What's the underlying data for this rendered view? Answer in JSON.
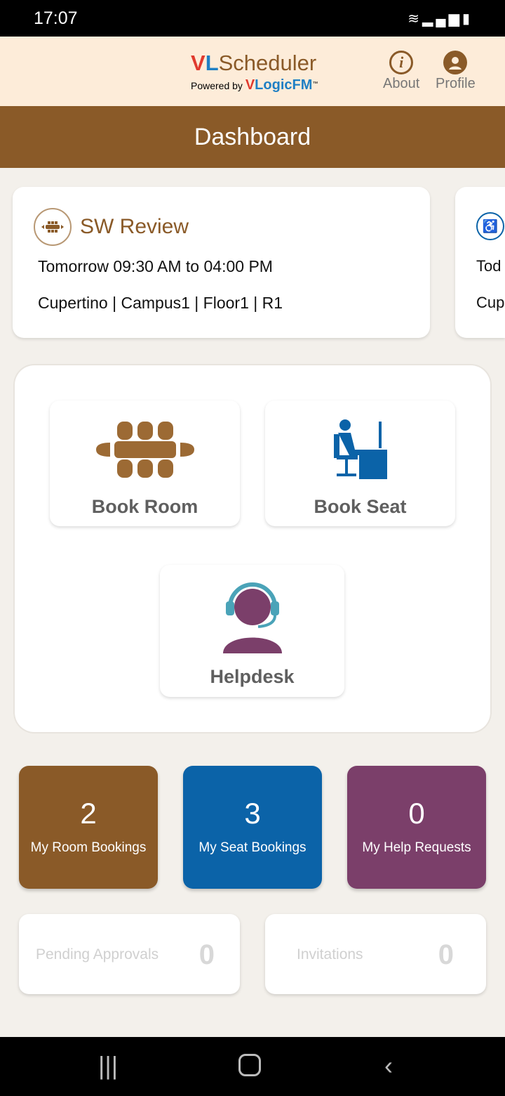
{
  "status_bar": {
    "time": "17:07",
    "icons": [
      "wifi-icon",
      "signal-icon",
      "battery-icon"
    ]
  },
  "header": {
    "logo_vl_v": "V",
    "logo_vl_l": "L",
    "logo_name": "Scheduler",
    "powered_by": "Powered by",
    "brand_v": "V",
    "brand_rest": "LogicFM",
    "tm": "™",
    "about": "About",
    "profile": "Profile"
  },
  "title": "Dashboard",
  "bookings": [
    {
      "title": "SW Review",
      "time": "Tomorrow 09:30 AM to 04:00 PM",
      "location": "Cupertino | Campus1 | Floor1 | R1",
      "icon": "meeting-table-icon"
    },
    {
      "title": "",
      "time": "Tod",
      "location": "Cup",
      "icon": "desk-seat-icon"
    }
  ],
  "actions": {
    "book_room": "Book Room",
    "book_seat": "Book Seat",
    "helpdesk": "Helpdesk"
  },
  "stats": [
    {
      "count": "2",
      "label": "My Room Bookings",
      "color": "#8a5a28"
    },
    {
      "count": "3",
      "label": "My Seat Bookings",
      "color": "#0b63a8"
    },
    {
      "count": "0",
      "label": "My Help Requests",
      "color": "#7b3f6a"
    }
  ],
  "pending": {
    "label": "Pending Approvals",
    "count": "0"
  },
  "invitations": {
    "label": "Invitations",
    "count": "0"
  }
}
